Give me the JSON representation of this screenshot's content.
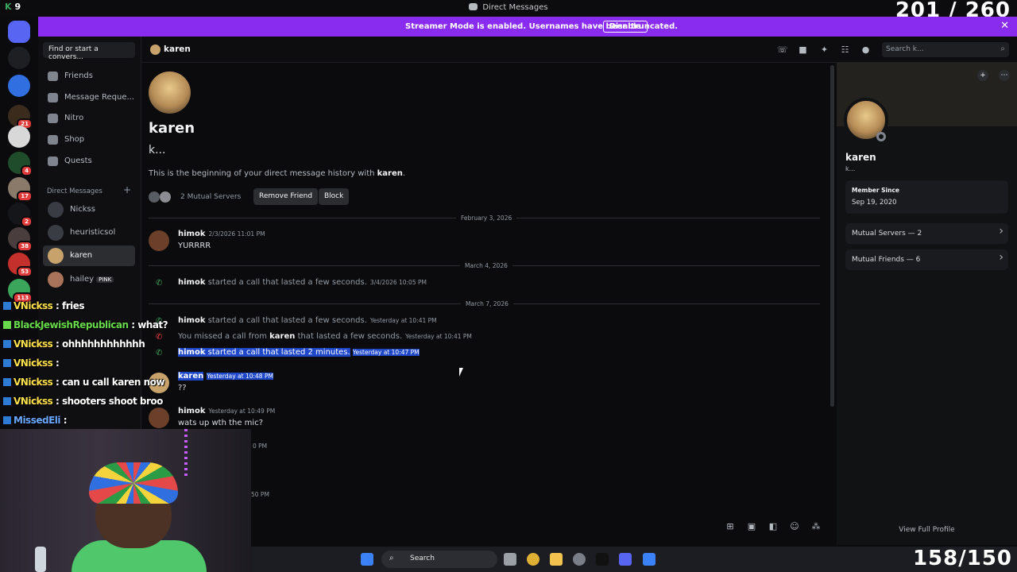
{
  "window": {
    "title": "Direct Messages"
  },
  "overlay": {
    "top_counter": "201 / 260",
    "bottom_counter": "158/150",
    "corner": "K",
    "corner_num": "9"
  },
  "banner": {
    "message": "Streamer Mode is enabled. Usernames have been truncated.",
    "button": "Disable"
  },
  "rail_badges": [
    "21",
    "4",
    "17",
    "2",
    "38",
    "53",
    "113"
  ],
  "sidebar": {
    "find_placeholder": "Find or start a convers...",
    "nav": [
      {
        "label": "Friends",
        "icon": "friends-icon"
      },
      {
        "label": "Message Reque...",
        "icon": "message-requests-icon"
      },
      {
        "label": "Nitro",
        "icon": "nitro-icon"
      },
      {
        "label": "Shop",
        "icon": "shop-icon"
      },
      {
        "label": "Quests",
        "icon": "quests-icon"
      }
    ],
    "dm_header": "Direct Messages",
    "dms": [
      {
        "name": "Nickss"
      },
      {
        "name": "heuristicsol"
      },
      {
        "name": "karen"
      },
      {
        "name": "hailey",
        "tag": "PINK"
      }
    ]
  },
  "header": {
    "name": "karen",
    "search_placeholder": "Search k..."
  },
  "chat": {
    "intro_name": "karen",
    "intro_sub": "k...",
    "beginning_prefix": "This is the beginning of your direct message history with ",
    "beginning_name": "karen",
    "mutual_servers": "2 Mutual Servers",
    "remove_friend": "Remove Friend",
    "block": "Block",
    "dividers": [
      "February 3, 2026",
      "March 4, 2026",
      "March 7, 2026"
    ],
    "messages": [
      {
        "author": "himok",
        "time": "2/3/2026 11:01 PM",
        "text": "YURRRR"
      },
      {
        "system_author": "himok",
        "system_text": "started a call that lasted a few seconds.",
        "time": "3/4/2026 10:05 PM"
      },
      {
        "system_author": "himok",
        "system_text": "started a call that lasted a few seconds.",
        "time": "Yesterday at 10:41 PM"
      },
      {
        "system_prefix": "You missed a call from ",
        "system_author": "karen",
        "system_text": " that lasted a few seconds.",
        "time": "Yesterday at 10:41 PM"
      },
      {
        "system_author": "himok",
        "system_text": " started a call that lasted 2 minutes.",
        "time": "Yesterday at 10:47 PM"
      },
      {
        "author": "karen",
        "time": "Yesterday at 10:48 PM",
        "text": "??"
      },
      {
        "author": "himok",
        "time": "Yesterday at 10:49 PM",
        "text": "wats up wth the mic?"
      }
    ],
    "partial_time_1": "0 PM",
    "partial_time_2": "50 PM"
  },
  "profile": {
    "name": "karen",
    "sub": "k...",
    "member_since_label": "Member Since",
    "member_since": "Sep 19, 2020",
    "mutual_servers": "Mutual Servers — 2",
    "mutual_friends": "Mutual Friends — 6",
    "view_full": "View Full Profile"
  },
  "stream_chat": [
    {
      "user": "VNickss",
      "text": ": fries"
    },
    {
      "user": "BlackJewishRepublican",
      "text": ": what?"
    },
    {
      "user": "VNickss",
      "text": ": ohhhhhhhhhhhh"
    },
    {
      "user": "VNickss",
      "text": ":"
    },
    {
      "user": "VNickss",
      "text": ": can u call karen now"
    },
    {
      "user": "VNickss",
      "text": ": shooters shoot broo"
    },
    {
      "user": "MissedEli",
      "text": ":"
    }
  ],
  "taskbar": {
    "search": "Search"
  }
}
